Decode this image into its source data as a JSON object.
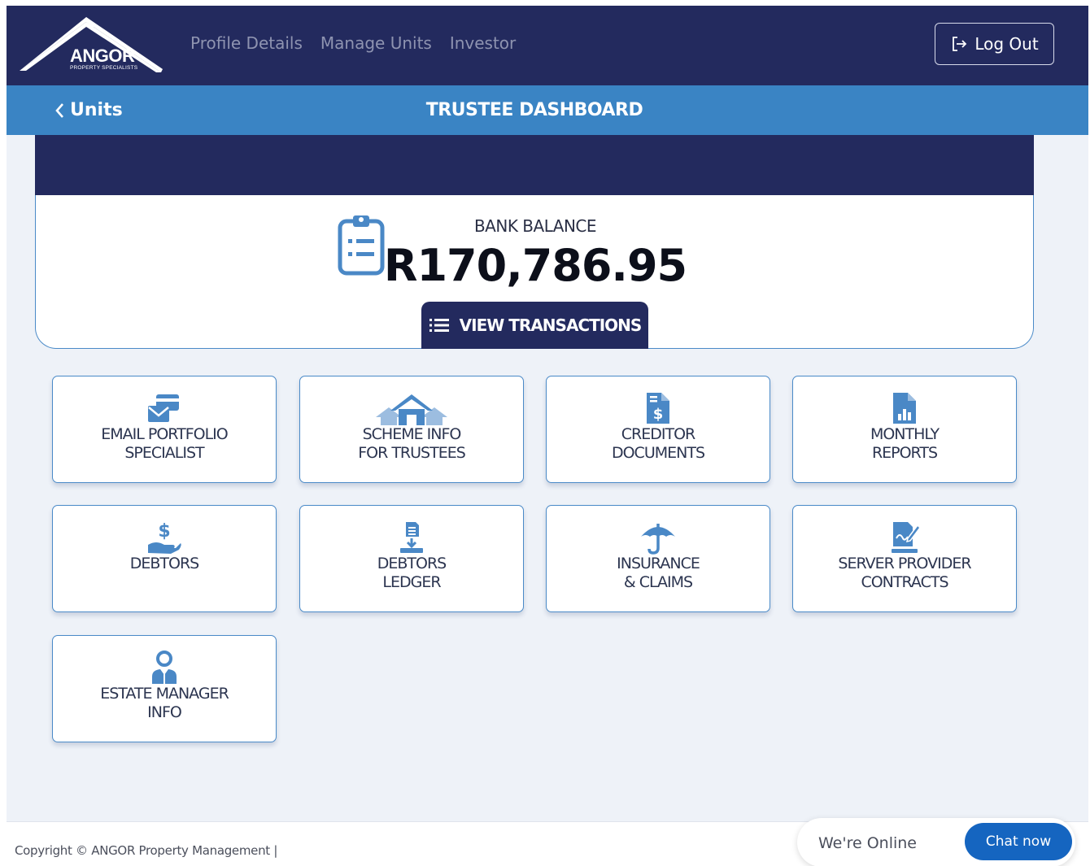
{
  "header": {
    "logo_text": "ANGOR",
    "logo_subtext": "PROPERTY SPECIALISTS",
    "nav": [
      "Profile Details",
      "Manage Units",
      "Investor"
    ],
    "logout_label": "Log Out"
  },
  "subheader": {
    "back_label": "Units",
    "title": "TRUSTEE DASHBOARD"
  },
  "balance": {
    "label": "BANK BALANCE",
    "value": "R170,786.95",
    "view_transactions_label": "VIEW TRANSACTIONS"
  },
  "tiles": [
    {
      "line1": "EMAIL PORTFOLIO",
      "line2": "SPECIALIST",
      "icon": "email-portfolio-icon"
    },
    {
      "line1": "SCHEME INFO",
      "line2": "FOR TRUSTEES",
      "icon": "houses-icon"
    },
    {
      "line1": "CREDITOR",
      "line2": "DOCUMENTS",
      "icon": "dollar-document-icon"
    },
    {
      "line1": "MONTHLY",
      "line2": "REPORTS",
      "icon": "chart-document-icon"
    },
    {
      "line1": "DEBTORS",
      "line2": "",
      "icon": "dollar-hand-icon"
    },
    {
      "line1": "DEBTORS",
      "line2": "LEDGER",
      "icon": "document-download-icon"
    },
    {
      "line1": "INSURANCE",
      "line2": "& CLAIMS",
      "icon": "umbrella-icon"
    },
    {
      "line1": "SERVER PROVIDER",
      "line2": "CONTRACTS",
      "icon": "contract-sign-icon"
    },
    {
      "line1": "ESTATE MANAGER",
      "line2": "INFO",
      "icon": "manager-person-icon"
    }
  ],
  "footer": {
    "copyright": "Copyright © ANGOR Property Management |"
  },
  "chat": {
    "status": "We're Online",
    "button_label": "Chat now"
  },
  "colors": {
    "navy": "#232a5e",
    "accent_blue": "#3a84c4",
    "chat_blue": "#1565c0",
    "background": "#eef2f8"
  }
}
